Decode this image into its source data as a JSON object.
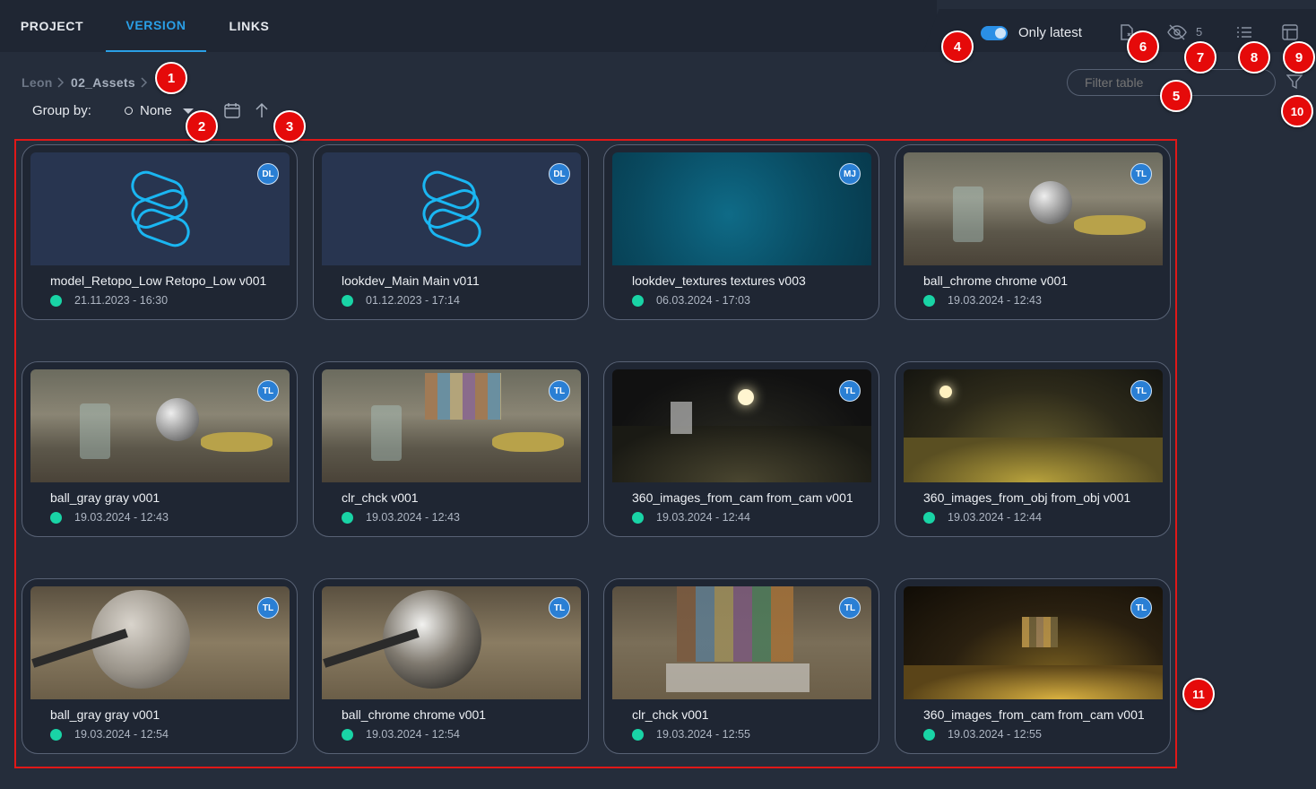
{
  "tabs": [
    {
      "label": "PROJECT",
      "active": false
    },
    {
      "label": "VERSION",
      "active": true
    },
    {
      "label": "LINKS",
      "active": false
    }
  ],
  "toolbar": {
    "only_latest_label": "Only latest",
    "only_latest_on": true,
    "hidden_count": "5",
    "filter_placeholder": "Filter table"
  },
  "breadcrumb": {
    "items": [
      "Leon",
      "02_Assets"
    ]
  },
  "group": {
    "label": "Group by:",
    "value": "None"
  },
  "cards": [
    {
      "title": "model_Retopo_Low Retopo_Low v001",
      "date": "21.11.2023 - 16:30",
      "user": "DL",
      "thumb": "logo"
    },
    {
      "title": "lookdev_Main Main v011",
      "date": "01.12.2023 - 17:14",
      "user": "DL",
      "thumb": "logo"
    },
    {
      "title": "lookdev_textures textures v003",
      "date": "06.03.2024 - 17:03",
      "user": "MJ",
      "thumb": "teal"
    },
    {
      "title": "ball_chrome chrome v001",
      "date": "19.03.2024 - 12:43",
      "user": "TL",
      "thumb": "room"
    },
    {
      "title": "ball_gray gray v001",
      "date": "19.03.2024 - 12:43",
      "user": "TL",
      "thumb": "room"
    },
    {
      "title": "clr_chck v001",
      "date": "19.03.2024 - 12:43",
      "user": "TL",
      "thumb": "room-chart"
    },
    {
      "title": "360_images_from_cam from_cam v001",
      "date": "19.03.2024 - 12:44",
      "user": "TL",
      "thumb": "pano"
    },
    {
      "title": "360_images_from_obj from_obj v001",
      "date": "19.03.2024 - 12:44",
      "user": "TL",
      "thumb": "pano-gold"
    },
    {
      "title": "ball_gray gray v001",
      "date": "19.03.2024 - 12:54",
      "user": "TL",
      "thumb": "ball-gray"
    },
    {
      "title": "ball_chrome chrome v001",
      "date": "19.03.2024 - 12:54",
      "user": "TL",
      "thumb": "ball-chrome"
    },
    {
      "title": "clr_chck v001",
      "date": "19.03.2024 - 12:55",
      "user": "TL",
      "thumb": "chart"
    },
    {
      "title": "360_images_from_cam from_cam v001",
      "date": "19.03.2024 - 12:55",
      "user": "TL",
      "thumb": "pano-dark"
    }
  ],
  "markers": [
    "1",
    "2",
    "3",
    "4",
    "5",
    "6",
    "7",
    "8",
    "9",
    "10",
    "11"
  ],
  "colors": {
    "accent": "#2a9fe6",
    "status_ok": "#19d4a6",
    "marker": "#e50a0a",
    "highlight_frame": "#e01818"
  }
}
